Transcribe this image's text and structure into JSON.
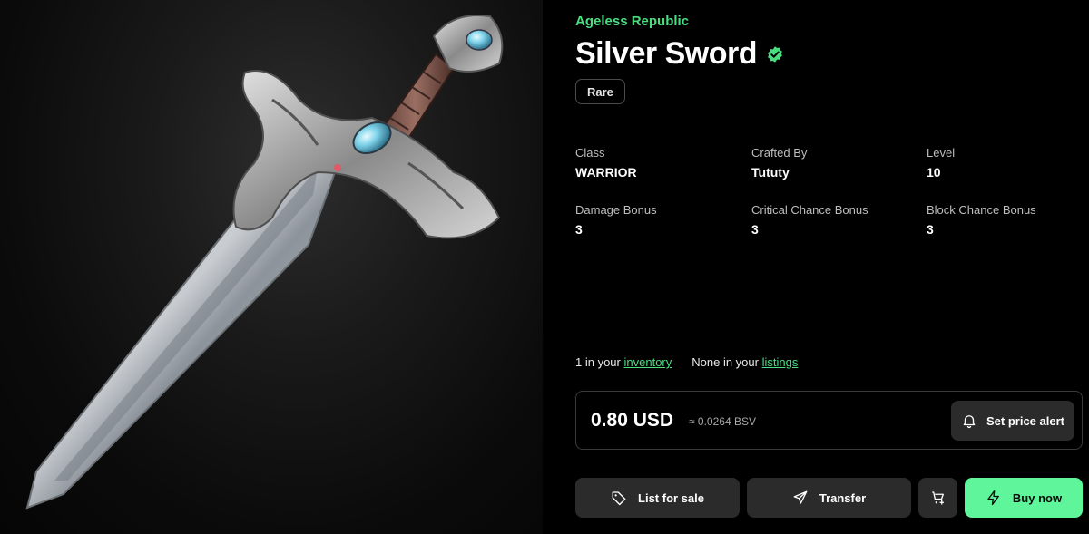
{
  "item": {
    "collection": "Ageless Republic",
    "name": "Silver Sword",
    "rarity": "Rare"
  },
  "stats": [
    {
      "label": "Class",
      "value": "WARRIOR"
    },
    {
      "label": "Crafted By",
      "value": "Tututy"
    },
    {
      "label": "Level",
      "value": "10"
    },
    {
      "label": "Damage Bonus",
      "value": "3"
    },
    {
      "label": "Critical Chance Bonus",
      "value": "3"
    },
    {
      "label": "Block Chance Bonus",
      "value": "3"
    }
  ],
  "ownership": {
    "inventory_prefix": "1 in your",
    "inventory_link": "inventory",
    "listings_prefix": "None in your",
    "listings_link": "listings"
  },
  "price": {
    "usd": "0.80 USD",
    "bsv": "≈ 0.0264 BSV",
    "alert_label": "Set price alert"
  },
  "actions": {
    "list_label": "List for sale",
    "transfer_label": "Transfer",
    "buy_label": "Buy now"
  },
  "icons": {
    "verified": "verified-badge-icon",
    "bell": "bell-icon",
    "tag": "tag-icon",
    "send": "send-icon",
    "cart": "cart-add-icon",
    "bolt": "lightning-icon"
  },
  "colors": {
    "accent": "#4ade80",
    "buy_button": "#5ff59a",
    "button_bg": "#2b2b2b",
    "background": "#000000"
  }
}
